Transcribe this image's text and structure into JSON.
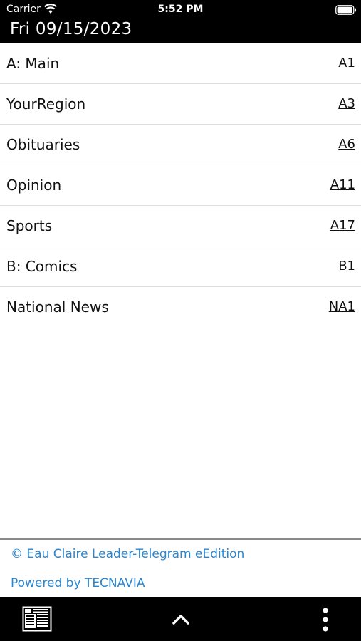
{
  "status_bar": {
    "carrier": "Carrier",
    "time": "5:52 PM"
  },
  "header": {
    "date": "Fri 09/15/2023"
  },
  "sections": [
    {
      "name": "A: Main",
      "page": "A1"
    },
    {
      "name": "YourRegion",
      "page": "A3"
    },
    {
      "name": "Obituaries",
      "page": "A6"
    },
    {
      "name": "Opinion",
      "page": "A11"
    },
    {
      "name": "Sports",
      "page": "A17"
    },
    {
      "name": "B: Comics",
      "page": "B1"
    },
    {
      "name": "National News",
      "page": "NA1"
    }
  ],
  "footer": {
    "copyright": "© Eau Claire Leader-Telegram eEdition",
    "powered_by": "Powered by TECNAVIA",
    "link_color": "#2a86d1"
  },
  "toolbar": {
    "icons": [
      "newspaper-icon",
      "chevron-up-icon",
      "more-vertical-icon"
    ]
  }
}
